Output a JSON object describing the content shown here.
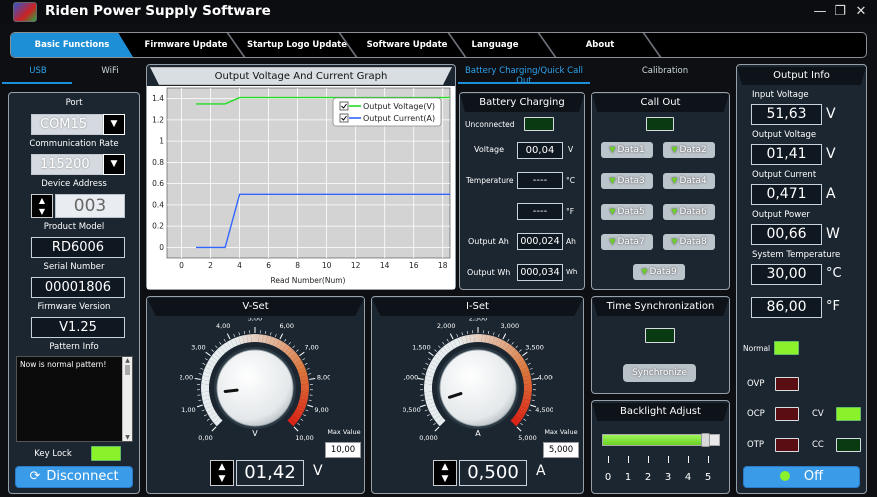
{
  "app": {
    "title": "Riden Power Supply Software"
  },
  "menu": [
    "Basic Functions",
    "Firmware Update",
    "Startup Logo Update",
    "Software Update",
    "Language",
    "About"
  ],
  "conn_tabs": [
    "USB",
    "WiFi"
  ],
  "device": {
    "port_label": "Port",
    "port_value": "COM15",
    "rate_label": "Communication Rate",
    "rate_value": "115200",
    "address_label": "Device Address",
    "address_value": "003",
    "model_label": "Product Model",
    "model_value": "RD6006",
    "serial_label": "Serial Number",
    "serial_value": "00001806",
    "firmware_label": "Firmware Version",
    "firmware_value": "V1.25",
    "pattern_label": "Pattern Info",
    "pattern_text": "Now is normal pattern!",
    "keylock_label": "Key Lock",
    "disconnect_label": "Disconnect"
  },
  "graph": {
    "title": "Output Voltage And Current Graph"
  },
  "chart_data": {
    "type": "line",
    "title": "Output Voltage And Current Graph",
    "xlabel": "Read Number(Num)",
    "ylabel": "",
    "xlim": [
      -1,
      18.5
    ],
    "ylim": [
      -0.1,
      1.5
    ],
    "xticks": [
      "0",
      "2",
      "4",
      "6",
      "8",
      "10",
      "12",
      "14",
      "16",
      "18"
    ],
    "yticks": [
      "0",
      "0.2",
      "0.4",
      "0.6",
      "0.8",
      "1",
      "1.2",
      "1.4"
    ],
    "grid": true,
    "legend": "top-right",
    "series": [
      {
        "name": "Output Voltage(V)",
        "color": "#22dd22",
        "x": [
          1,
          2,
          3,
          4,
          5,
          6,
          7,
          8,
          9,
          10,
          11,
          12,
          13,
          14,
          15,
          16,
          17,
          18.5
        ],
        "values": [
          1.35,
          1.35,
          1.35,
          1.41,
          1.41,
          1.41,
          1.41,
          1.41,
          1.41,
          1.41,
          1.41,
          1.41,
          1.41,
          1.41,
          1.41,
          1.41,
          1.41,
          1.41
        ]
      },
      {
        "name": "Output Current(A)",
        "color": "#3366ff",
        "x": [
          1,
          2,
          3,
          4,
          5,
          6,
          7,
          8,
          9,
          10,
          11,
          12,
          13,
          14,
          15,
          16,
          17,
          18.5
        ],
        "values": [
          0,
          0,
          0,
          0.5,
          0.5,
          0.5,
          0.5,
          0.5,
          0.5,
          0.5,
          0.5,
          0.5,
          0.5,
          0.5,
          0.5,
          0.5,
          0.5,
          0.5
        ]
      }
    ]
  },
  "mid_tabs": [
    "Battery Charging/Quick Call Out",
    "Calibration"
  ],
  "battery": {
    "title": "Battery Charging",
    "status": "Unconnected",
    "voltage_label": "Voltage",
    "voltage_value": "00,04",
    "voltage_unit": "V",
    "temp_label": "Temperature",
    "temp_c": "----",
    "temp_c_unit": "°C",
    "temp_f": "----",
    "temp_f_unit": "°F",
    "ah_label": "Output Ah",
    "ah_value": "000,024",
    "ah_unit": "Ah",
    "wh_label": "Output Wh",
    "wh_value": "000,034",
    "wh_unit": "Wh"
  },
  "callout": {
    "title": "Call Out",
    "buttons": [
      "Data1",
      "Data2",
      "Data3",
      "Data4",
      "Data5",
      "Data6",
      "Data7",
      "Data8",
      "Data9"
    ]
  },
  "timesync": {
    "title": "Time Synchronization",
    "button": "Synchronize"
  },
  "backlight": {
    "title": "Backlight Adjust",
    "ticks": [
      "0",
      "1",
      "2",
      "3",
      "4",
      "5"
    ],
    "level": 0.87
  },
  "vset": {
    "title": "V-Set",
    "ticks": [
      "0,00",
      "1,00",
      "2,00",
      "3,00",
      "4,00",
      "5,00",
      "6,00",
      "7,00",
      "8,00",
      "9,00",
      "10,00"
    ],
    "unit_dial": "V",
    "max_label": "Max Value",
    "max_value": "10,00",
    "value": "01,42",
    "unit": "V",
    "needle": 1.42,
    "dial_max": 10
  },
  "iset": {
    "title": "I-Set",
    "ticks": [
      "0,000",
      "0,500",
      "1,000",
      "1,500",
      "2,000",
      "2,500",
      "3,000",
      "3,500",
      "4,000",
      "4,500",
      "5,000"
    ],
    "unit_dial": "A",
    "max_label": "Max Value",
    "max_value": "5,000",
    "value": "0,500",
    "unit": "A",
    "needle": 0.5,
    "dial_max": 5
  },
  "output": {
    "title": "Output Info",
    "in_v_label": "Input Voltage",
    "in_v": "51,63",
    "in_v_unit": "V",
    "out_v_label": "Output Voltage",
    "out_v": "01,41",
    "out_v_unit": "V",
    "out_i_label": "Output Current",
    "out_i": "0,471",
    "out_i_unit": "A",
    "out_p_label": "Output Power",
    "out_p": "00,66",
    "out_p_unit": "W",
    "temp_label": "System Temperature",
    "temp_c": "30,00",
    "temp_c_unit": "°C",
    "temp_f": "86,00",
    "temp_f_unit": "°F",
    "normal": "Normal",
    "ovp": "OVP",
    "ocp": "OCP",
    "otp": "OTP",
    "cv": "CV",
    "cc": "CC",
    "power_button": "Off"
  }
}
